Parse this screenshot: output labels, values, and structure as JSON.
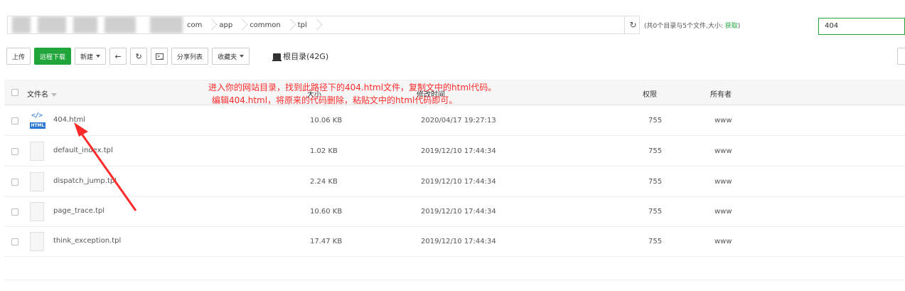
{
  "path": {
    "crumbs": [
      "com",
      "app",
      "common",
      "tpl"
    ]
  },
  "dir_info": {
    "text": "(共0个目录与5个文件,大小: ",
    "fetch": "获取",
    "close": ")"
  },
  "search": {
    "value": "404"
  },
  "toolbar": {
    "upload": "上传",
    "remote_download": "远程下载",
    "new": "新建",
    "back_icon": "arrow-left-icon",
    "refresh_icon": "refresh-icon",
    "terminal_icon": "terminal-icon",
    "share_list": "分享列表",
    "favorites": "收藏夹",
    "root_dir": "根目录(42G)",
    "accent": "#20a53a"
  },
  "table": {
    "headers": {
      "name": "文件名",
      "size": "大小",
      "mtime": "修改时间",
      "perm": "权限",
      "owner": "所有者"
    },
    "rows": [
      {
        "name": "404.html",
        "size": "10.06 KB",
        "mtime": "2020/04/17 19:27:13",
        "perm": "755",
        "owner": "www",
        "icon": "html"
      },
      {
        "name": "default_index.tpl",
        "size": "1.02 KB",
        "mtime": "2019/12/10 17:44:34",
        "perm": "755",
        "owner": "www",
        "icon": "file"
      },
      {
        "name": "dispatch_jump.tpl",
        "size": "2.24 KB",
        "mtime": "2019/12/10 17:44:34",
        "perm": "755",
        "owner": "www",
        "icon": "file"
      },
      {
        "name": "page_trace.tpl",
        "size": "10.60 KB",
        "mtime": "2019/12/10 17:44:34",
        "perm": "755",
        "owner": "www",
        "icon": "file"
      },
      {
        "name": "think_exception.tpl",
        "size": "17.47 KB",
        "mtime": "2019/12/10 17:44:34",
        "perm": "755",
        "owner": "www",
        "icon": "file"
      }
    ]
  },
  "annotation": {
    "line1": "进入你的网站目录，找到此路径下的404.html文件，复制文中的html代码。",
    "line2": "编辑404.html，将原来的代码删除，粘贴文中的html代码即可。",
    "color": "#ff2b2b"
  }
}
